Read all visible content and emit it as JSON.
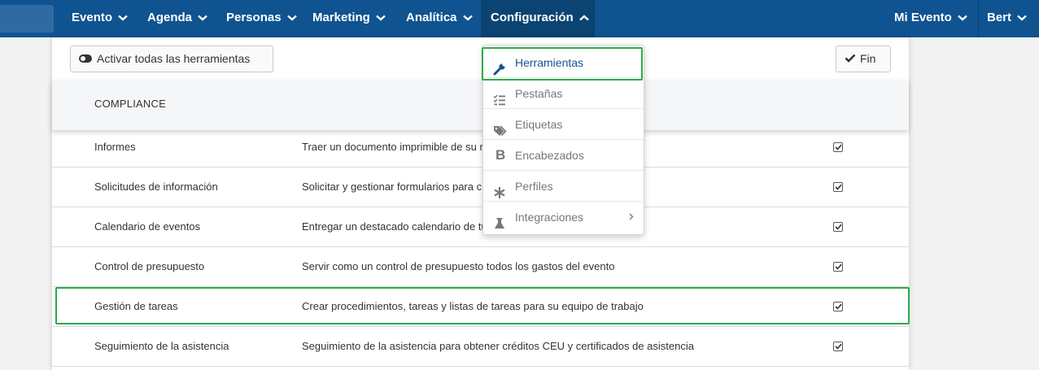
{
  "nav": {
    "items": [
      {
        "label": "Evento"
      },
      {
        "label": "Agenda"
      },
      {
        "label": "Personas"
      },
      {
        "label": "Marketing"
      },
      {
        "label": "Analítica"
      },
      {
        "label": "Configuración"
      },
      {
        "label": "Mi Evento"
      },
      {
        "label": "Bert"
      }
    ]
  },
  "toolbar": {
    "activate_label": "Activar todas las herramientas",
    "fin_label": "Fin"
  },
  "section": {
    "title": "COMPLIANCE"
  },
  "rows": [
    {
      "name": "Informes",
      "desc": "Traer un documento imprimible de su r",
      "enabled": true
    },
    {
      "name": "Solicitudes de información",
      "desc": "Solicitar y gestionar formularios para c                                                  ntillas",
      "enabled": true
    },
    {
      "name": "Calendario de eventos",
      "desc": "Entregar un destacado calendario de tu                                                  as de gestión",
      "enabled": true
    },
    {
      "name": "Control de presupuesto",
      "desc": "Servir como un control de presupuesto todos los gastos del evento",
      "enabled": true
    },
    {
      "name": "Gestión de tareas",
      "desc": "Crear procedimientos, tareas y listas de tareas para su equipo de trabajo",
      "enabled": true
    },
    {
      "name": "Seguimiento de la asistencia",
      "desc": "Seguimiento de la asistencia para obtener créditos CEU y certificados de asistencia",
      "enabled": true
    }
  ],
  "dropdown": {
    "items": [
      {
        "label": "Herramientas",
        "icon": "wrench-icon",
        "active": true
      },
      {
        "label": "Pestañas",
        "icon": "list-check-icon"
      },
      {
        "label": "Etiquetas",
        "icon": "tags-icon"
      },
      {
        "label": "Encabezados",
        "icon": "bold-icon"
      },
      {
        "label": "Perfiles",
        "icon": "asterisk-icon"
      },
      {
        "label": "Integraciones",
        "icon": "flask-icon",
        "has_submenu": true
      }
    ]
  },
  "colors": {
    "nav_bg": "#0f5391",
    "highlight": "#2eaa4a",
    "active_text": "#0f5391"
  }
}
